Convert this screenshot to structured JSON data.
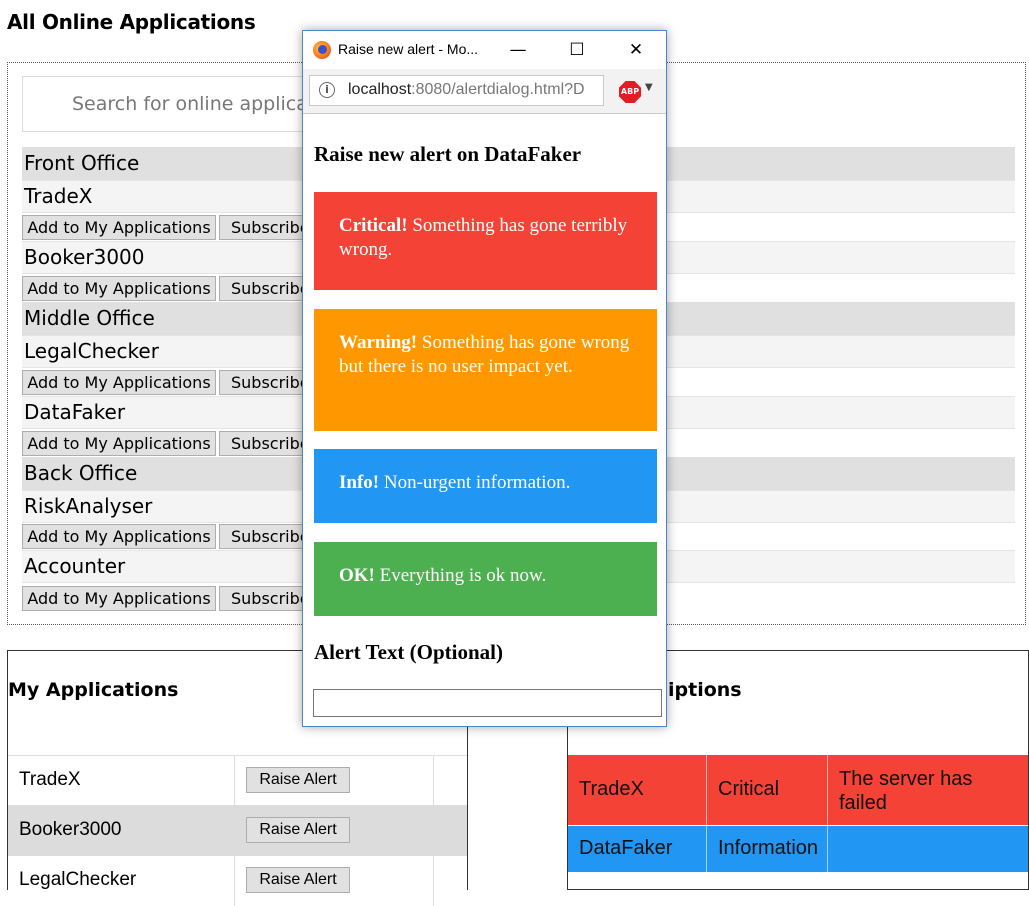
{
  "page": {
    "title": "All Online Applications",
    "search_placeholder": "Search for online applications"
  },
  "online": {
    "add_label": "Add to My Applications",
    "subscribe_label": "Subscribe",
    "categories": [
      {
        "name": "Front Office",
        "apps": [
          "TradeX",
          "Booker3000"
        ]
      },
      {
        "name": "Middle Office",
        "apps": [
          "LegalChecker",
          "DataFaker"
        ]
      },
      {
        "name": "Back Office",
        "apps": [
          "RiskAnalyser",
          "Accounter"
        ]
      }
    ]
  },
  "my_apps": {
    "title": "My Applications",
    "raise_label": "Raise Alert",
    "items": [
      "TradeX",
      "Booker3000",
      "LegalChecker"
    ]
  },
  "subscriptions": {
    "title_visible": "iptions",
    "rows": [
      {
        "app": "TradeX",
        "level": "Critical",
        "text": "The server has failed",
        "color": "#f44336"
      },
      {
        "app": "DataFaker",
        "level": "Information",
        "text": "",
        "color": "#2196f3"
      }
    ]
  },
  "popup": {
    "window_title": "Raise new alert - Mo...",
    "url_host": "localhost",
    "url_rest": ":8080/alertdialog.html?D",
    "abp_label": "ABP",
    "heading": "Raise new alert on DataFaker",
    "alerts": {
      "critical": {
        "label": "Critical!",
        "text": "Something has gone terribly wrong.",
        "color": "#f44336"
      },
      "warning": {
        "label": "Warning!",
        "text": "Something has gone wrong but there is no user impact yet.",
        "color": "#ff9800"
      },
      "info": {
        "label": "Info!",
        "text": "Non-urgent information.",
        "color": "#2196f3"
      },
      "ok": {
        "label": "OK!",
        "text": "Everything is ok now.",
        "color": "#4caf50"
      }
    },
    "alert_text_title": "Alert Text (Optional)",
    "alert_text_value": ""
  }
}
